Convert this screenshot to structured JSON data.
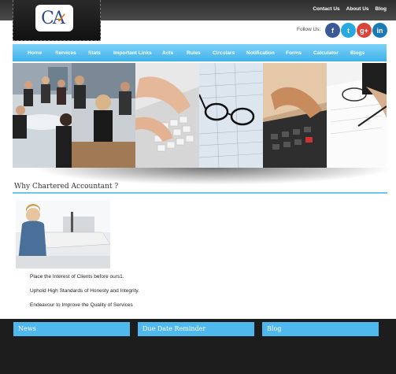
{
  "logo": {
    "text": "CA"
  },
  "top_links": [
    "Contact Us",
    "About Us",
    "Blog"
  ],
  "follow": {
    "label": "Follow Us:",
    "icons": [
      "facebook-icon",
      "twitter-icon",
      "google-plus-icon",
      "linkedin-icon"
    ],
    "glyphs": [
      "f",
      "t",
      "g+",
      "in"
    ]
  },
  "nav": [
    "Home",
    "Services",
    "Stats",
    "Important Links",
    "Acts",
    "Rules",
    "Circulars",
    "Notification",
    "Forms",
    "Calculator",
    "Blogs"
  ],
  "section": {
    "title": "Why Chartered Accountant ?"
  },
  "bullets": [
    "Place the Interest of Clients before ours1.",
    "Uphold High Standards of Honesty and Integrity.",
    "Endeavour to Improve the Quality of Services"
  ],
  "footer": {
    "tabs": [
      "News",
      "Due Date Reminder",
      "Blog"
    ]
  },
  "colors": {
    "accent": "#4fb8ec",
    "dark": "#1d1d1d"
  }
}
